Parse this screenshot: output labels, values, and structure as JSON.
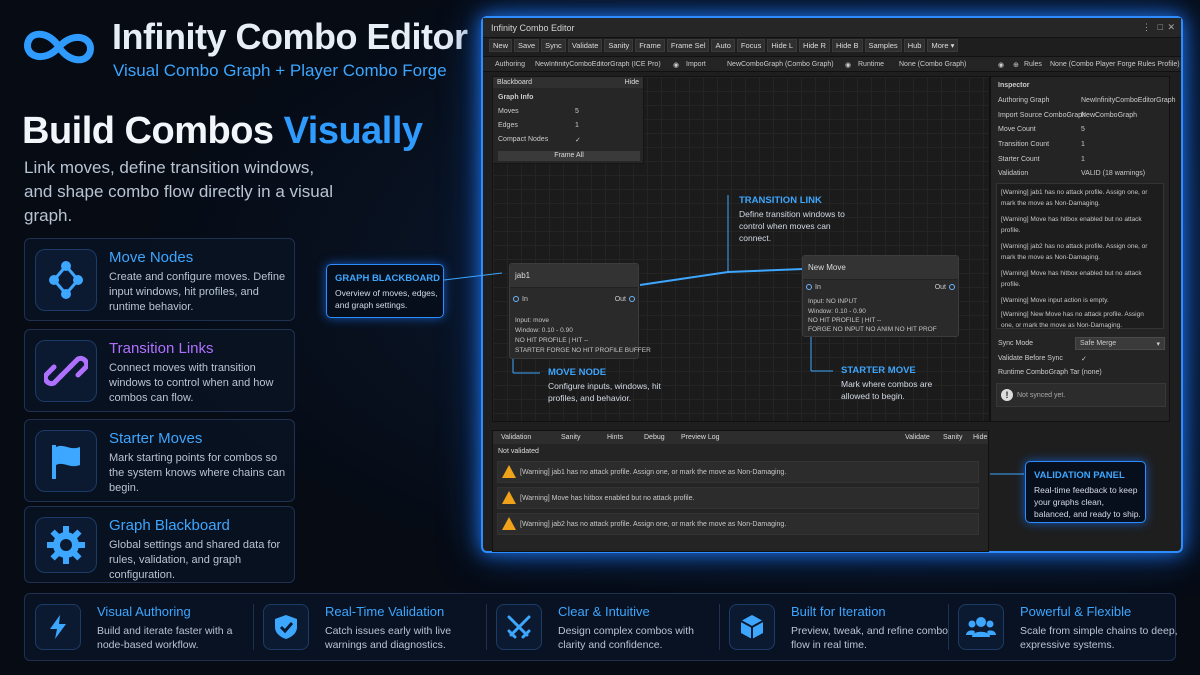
{
  "header": {
    "title": "Infinity Combo Editor",
    "subtitle": "Visual Combo Graph + Player Combo Forge"
  },
  "hero": {
    "heading_white": "Build Combos",
    "heading_blue": "Visually",
    "intro": "Link moves, define transition windows, and shape combo flow directly in a visual graph."
  },
  "cards": [
    {
      "title": "Move Nodes",
      "desc": "Create and configure moves. Define input windows, hit profiles, and runtime behavior.",
      "icon": "nodes-icon",
      "color": "#3da6ff"
    },
    {
      "title": "Transition Links",
      "desc": "Connect moves with transition windows to control when and how combos can flow.",
      "icon": "link-icon",
      "color": "#b070ff"
    },
    {
      "title": "Starter Moves",
      "desc": "Mark starting points for combos so the system knows where chains can begin.",
      "icon": "flag-icon",
      "color": "#3da6ff"
    },
    {
      "title": "Graph Blackboard",
      "desc": "Global settings and shared data for rules, validation, and graph configuration.",
      "icon": "gear-icon",
      "color": "#3da6ff"
    }
  ],
  "features": [
    {
      "title": "Visual Authoring",
      "desc": "Build and iterate faster with a node-based workflow.",
      "icon": "lightning-icon"
    },
    {
      "title": "Real-Time Validation",
      "desc": "Catch issues early with live warnings and diagnostics.",
      "icon": "shield-check-icon"
    },
    {
      "title": "Clear & Intuitive",
      "desc": "Design complex combos with clarity and confidence.",
      "icon": "crossed-swords-icon"
    },
    {
      "title": "Built for Iteration",
      "desc": "Preview, tweak, and refine combo flow in real time.",
      "icon": "cube-icon"
    },
    {
      "title": "Powerful & Flexible",
      "desc": "Scale from simple chains to deep, expressive systems.",
      "icon": "users-icon"
    }
  ],
  "editor": {
    "window_title": "Infinity Combo Editor",
    "toolbar": [
      "New",
      "Save",
      "Sync",
      "Validate",
      "Sanity",
      "Frame",
      "Frame Sel",
      "Auto",
      "Focus",
      "Hide L",
      "Hide R",
      "Hide B",
      "Samples",
      "Hub",
      "More ▾"
    ],
    "assets": {
      "authoring_label": "Authoring",
      "authoring_value": "NewInfinityComboEditorGraph (ICE Pro)",
      "import_label": "Import",
      "import_value": "NewComboGraph (Combo Graph)",
      "runtime_label": "Runtime",
      "runtime_value": "None (Combo Graph)",
      "rules_label": "Rules",
      "rules_value": "None (Combo Player Forge Rules Profile)"
    },
    "blackboard": {
      "title": "Blackboard",
      "hide": "Hide",
      "section": "Graph Info",
      "moves_label": "Moves",
      "moves_value": "5",
      "edges_label": "Edges",
      "edges_value": "1",
      "compact_label": "Compact Nodes",
      "compact_value": "✓",
      "frame_all": "Frame All"
    },
    "node_jab": {
      "title": "jab1",
      "in": "In",
      "out": "Out",
      "l1": "Input: move",
      "l2": "Window: 0.10 - 0.90",
      "l3": "NO HIT PROFILE  |  HIT --",
      "l4": "STARTER  FORGE  NO HIT PROFILE BUFFER"
    },
    "node_new": {
      "title": "New Move",
      "in": "In",
      "out": "Out",
      "l1": "Input: NO INPUT",
      "l2": "Window: 0.10 - 0.90",
      "l3": "NO HIT PROFILE  |  HIT --",
      "l4": "FORGE  NO INPUT  NO ANIM  NO HIT PROF"
    },
    "inspector": {
      "title": "Inspector",
      "rows": [
        {
          "label": "Authoring Graph",
          "value": "NewInfinityComboEditorGraph"
        },
        {
          "label": "Import Source ComboGraph",
          "value": "NewComboGraph"
        },
        {
          "label": "Move Count",
          "value": "5"
        },
        {
          "label": "Transition Count",
          "value": "1"
        },
        {
          "label": "Starter Count",
          "value": "1"
        },
        {
          "label": "Validation",
          "value": "VALID (18 warnings)"
        }
      ],
      "warnings": [
        "[Warning] jab1 has no attack profile. Assign one, or mark the move as Non-Damaging.",
        "[Warning] Move has hitbox enabled but no attack profile.",
        "[Warning] jab2 has no attack profile. Assign one, or mark the move as Non-Damaging.",
        "[Warning] Move has hitbox enabled but no attack profile.",
        "[Warning] Move input action is empty.",
        "[Warning] New Move has no attack profile. Assign one, or mark the move as Non-Damaging."
      ],
      "sync_mode_label": "Sync Mode",
      "sync_mode_value": "Safe Merge",
      "validate_label": "Validate Before Sync",
      "validate_value": "✓",
      "runtime_label": "Runtime ComboGraph Tar (none)",
      "not_synced": "Not synced yet."
    },
    "validation": {
      "tabs": [
        "Validation",
        "Sanity",
        "Hints",
        "Debug",
        "Preview Log"
      ],
      "right_tabs": [
        "Validate",
        "Sanity",
        "Hide"
      ],
      "status": "Not validated",
      "rows": [
        "[Warning] jab1 has no attack profile. Assign one, or mark the move as Non-Damaging.",
        "[Warning] Move has hitbox enabled but no attack profile.",
        "[Warning] jab2 has no attack profile. Assign one, or mark the move as Non-Damaging."
      ]
    }
  },
  "callouts": {
    "transition": {
      "title": "TRANSITION LINK",
      "desc": "Define transition windows to control when moves can connect."
    },
    "blackboard": {
      "title": "GRAPH BLACKBOARD",
      "desc": "Overview of moves, edges, and graph settings."
    },
    "move_node": {
      "title": "MOVE NODE",
      "desc": "Configure inputs, windows, hit profiles, and behavior."
    },
    "starter": {
      "title": "STARTER MOVE",
      "desc": "Mark where combos are allowed to begin."
    },
    "validation": {
      "title": "VALIDATION PANEL",
      "desc": "Real-time feedback to keep your graphs clean, balanced, and ready to ship."
    }
  },
  "colors": {
    "accent": "#2d8cff",
    "purple": "#b070ff",
    "warning": "#f0a21a"
  }
}
